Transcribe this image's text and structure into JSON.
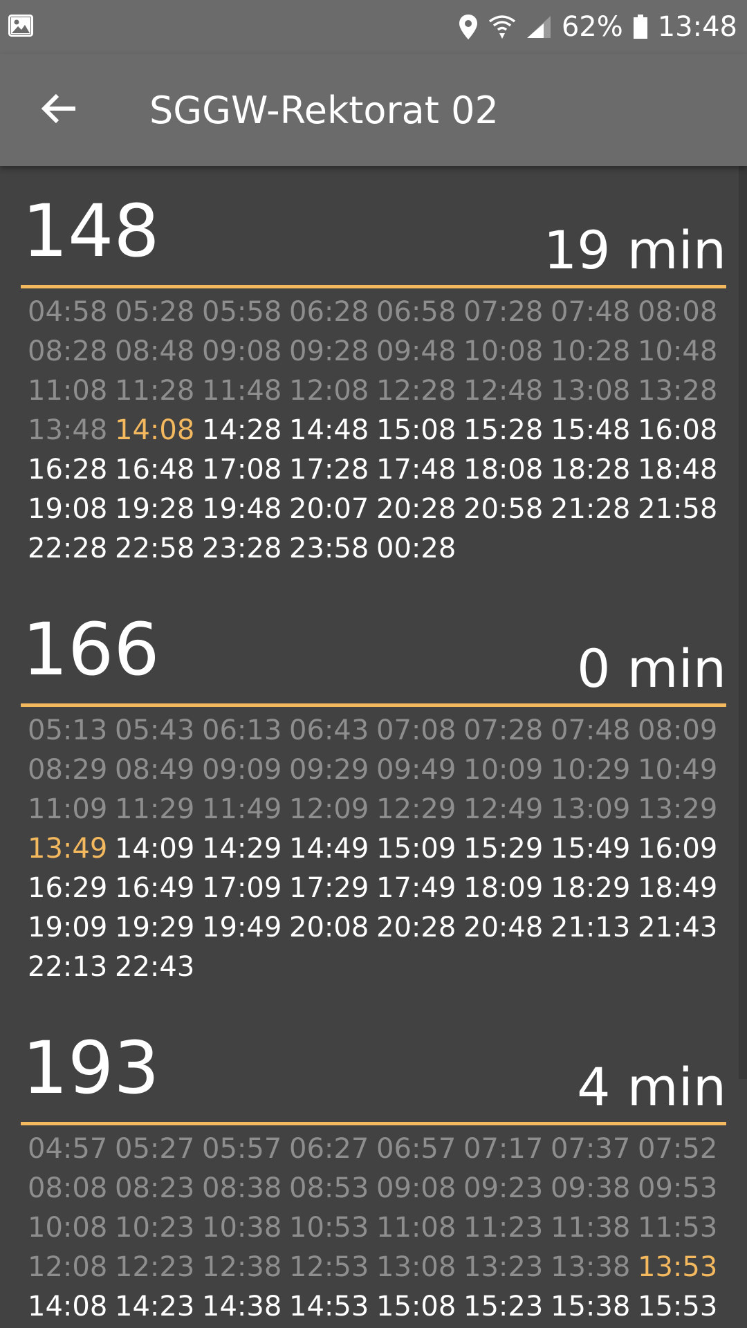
{
  "status_bar": {
    "battery": "62%",
    "time": "13:48",
    "icons": [
      "gallery-icon",
      "location-icon",
      "wifi-icon",
      "signal-icon",
      "battery-icon"
    ]
  },
  "app_bar": {
    "title": "SGGW-Rektorat 02",
    "back_icon": "back-arrow-icon"
  },
  "colors": {
    "accent": "#f4b95e",
    "background": "#424242",
    "toolbar": "#6b6b6b",
    "past_time": "#8e8e8e",
    "upcoming_time": "#ffffff"
  },
  "lines": [
    {
      "number": "148",
      "eta": "19 min",
      "times": [
        {
          "t": "04:58",
          "s": "past"
        },
        {
          "t": "05:28",
          "s": "past"
        },
        {
          "t": "05:58",
          "s": "past"
        },
        {
          "t": "06:28",
          "s": "past"
        },
        {
          "t": "06:58",
          "s": "past"
        },
        {
          "t": "07:28",
          "s": "past"
        },
        {
          "t": "07:48",
          "s": "past"
        },
        {
          "t": "08:08",
          "s": "past"
        },
        {
          "t": "08:28",
          "s": "past"
        },
        {
          "t": "08:48",
          "s": "past"
        },
        {
          "t": "09:08",
          "s": "past"
        },
        {
          "t": "09:28",
          "s": "past"
        },
        {
          "t": "09:48",
          "s": "past"
        },
        {
          "t": "10:08",
          "s": "past"
        },
        {
          "t": "10:28",
          "s": "past"
        },
        {
          "t": "10:48",
          "s": "past"
        },
        {
          "t": "11:08",
          "s": "past"
        },
        {
          "t": "11:28",
          "s": "past"
        },
        {
          "t": "11:48",
          "s": "past"
        },
        {
          "t": "12:08",
          "s": "past"
        },
        {
          "t": "12:28",
          "s": "past"
        },
        {
          "t": "12:48",
          "s": "past"
        },
        {
          "t": "13:08",
          "s": "past"
        },
        {
          "t": "13:28",
          "s": "past"
        },
        {
          "t": "13:48",
          "s": "past"
        },
        {
          "t": "14:08",
          "s": "next"
        },
        {
          "t": "14:28",
          "s": "upcoming"
        },
        {
          "t": "14:48",
          "s": "upcoming"
        },
        {
          "t": "15:08",
          "s": "upcoming"
        },
        {
          "t": "15:28",
          "s": "upcoming"
        },
        {
          "t": "15:48",
          "s": "upcoming"
        },
        {
          "t": "16:08",
          "s": "upcoming"
        },
        {
          "t": "16:28",
          "s": "upcoming"
        },
        {
          "t": "16:48",
          "s": "upcoming"
        },
        {
          "t": "17:08",
          "s": "upcoming"
        },
        {
          "t": "17:28",
          "s": "upcoming"
        },
        {
          "t": "17:48",
          "s": "upcoming"
        },
        {
          "t": "18:08",
          "s": "upcoming"
        },
        {
          "t": "18:28",
          "s": "upcoming"
        },
        {
          "t": "18:48",
          "s": "upcoming"
        },
        {
          "t": "19:08",
          "s": "upcoming"
        },
        {
          "t": "19:28",
          "s": "upcoming"
        },
        {
          "t": "19:48",
          "s": "upcoming"
        },
        {
          "t": "20:07",
          "s": "upcoming"
        },
        {
          "t": "20:28",
          "s": "upcoming"
        },
        {
          "t": "20:58",
          "s": "upcoming"
        },
        {
          "t": "21:28",
          "s": "upcoming"
        },
        {
          "t": "21:58",
          "s": "upcoming"
        },
        {
          "t": "22:28",
          "s": "upcoming"
        },
        {
          "t": "22:58",
          "s": "upcoming"
        },
        {
          "t": "23:28",
          "s": "upcoming"
        },
        {
          "t": "23:58",
          "s": "upcoming"
        },
        {
          "t": "00:28",
          "s": "upcoming"
        }
      ]
    },
    {
      "number": "166",
      "eta": "0 min",
      "times": [
        {
          "t": "05:13",
          "s": "past"
        },
        {
          "t": "05:43",
          "s": "past"
        },
        {
          "t": "06:13",
          "s": "past"
        },
        {
          "t": "06:43",
          "s": "past"
        },
        {
          "t": "07:08",
          "s": "past"
        },
        {
          "t": "07:28",
          "s": "past"
        },
        {
          "t": "07:48",
          "s": "past"
        },
        {
          "t": "08:09",
          "s": "past"
        },
        {
          "t": "08:29",
          "s": "past"
        },
        {
          "t": "08:49",
          "s": "past"
        },
        {
          "t": "09:09",
          "s": "past"
        },
        {
          "t": "09:29",
          "s": "past"
        },
        {
          "t": "09:49",
          "s": "past"
        },
        {
          "t": "10:09",
          "s": "past"
        },
        {
          "t": "10:29",
          "s": "past"
        },
        {
          "t": "10:49",
          "s": "past"
        },
        {
          "t": "11:09",
          "s": "past"
        },
        {
          "t": "11:29",
          "s": "past"
        },
        {
          "t": "11:49",
          "s": "past"
        },
        {
          "t": "12:09",
          "s": "past"
        },
        {
          "t": "12:29",
          "s": "past"
        },
        {
          "t": "12:49",
          "s": "past"
        },
        {
          "t": "13:09",
          "s": "past"
        },
        {
          "t": "13:29",
          "s": "past"
        },
        {
          "t": "13:49",
          "s": "next"
        },
        {
          "t": "14:09",
          "s": "upcoming"
        },
        {
          "t": "14:29",
          "s": "upcoming"
        },
        {
          "t": "14:49",
          "s": "upcoming"
        },
        {
          "t": "15:09",
          "s": "upcoming"
        },
        {
          "t": "15:29",
          "s": "upcoming"
        },
        {
          "t": "15:49",
          "s": "upcoming"
        },
        {
          "t": "16:09",
          "s": "upcoming"
        },
        {
          "t": "16:29",
          "s": "upcoming"
        },
        {
          "t": "16:49",
          "s": "upcoming"
        },
        {
          "t": "17:09",
          "s": "upcoming"
        },
        {
          "t": "17:29",
          "s": "upcoming"
        },
        {
          "t": "17:49",
          "s": "upcoming"
        },
        {
          "t": "18:09",
          "s": "upcoming"
        },
        {
          "t": "18:29",
          "s": "upcoming"
        },
        {
          "t": "18:49",
          "s": "upcoming"
        },
        {
          "t": "19:09",
          "s": "upcoming"
        },
        {
          "t": "19:29",
          "s": "upcoming"
        },
        {
          "t": "19:49",
          "s": "upcoming"
        },
        {
          "t": "20:08",
          "s": "upcoming"
        },
        {
          "t": "20:28",
          "s": "upcoming"
        },
        {
          "t": "20:48",
          "s": "upcoming"
        },
        {
          "t": "21:13",
          "s": "upcoming"
        },
        {
          "t": "21:43",
          "s": "upcoming"
        },
        {
          "t": "22:13",
          "s": "upcoming"
        },
        {
          "t": "22:43",
          "s": "upcoming"
        }
      ]
    },
    {
      "number": "193",
      "eta": "4 min",
      "times": [
        {
          "t": "04:57",
          "s": "past"
        },
        {
          "t": "05:27",
          "s": "past"
        },
        {
          "t": "05:57",
          "s": "past"
        },
        {
          "t": "06:27",
          "s": "past"
        },
        {
          "t": "06:57",
          "s": "past"
        },
        {
          "t": "07:17",
          "s": "past"
        },
        {
          "t": "07:37",
          "s": "past"
        },
        {
          "t": "07:52",
          "s": "past"
        },
        {
          "t": "08:08",
          "s": "past"
        },
        {
          "t": "08:23",
          "s": "past"
        },
        {
          "t": "08:38",
          "s": "past"
        },
        {
          "t": "08:53",
          "s": "past"
        },
        {
          "t": "09:08",
          "s": "past"
        },
        {
          "t": "09:23",
          "s": "past"
        },
        {
          "t": "09:38",
          "s": "past"
        },
        {
          "t": "09:53",
          "s": "past"
        },
        {
          "t": "10:08",
          "s": "past"
        },
        {
          "t": "10:23",
          "s": "past"
        },
        {
          "t": "10:38",
          "s": "past"
        },
        {
          "t": "10:53",
          "s": "past"
        },
        {
          "t": "11:08",
          "s": "past"
        },
        {
          "t": "11:23",
          "s": "past"
        },
        {
          "t": "11:38",
          "s": "past"
        },
        {
          "t": "11:53",
          "s": "past"
        },
        {
          "t": "12:08",
          "s": "past"
        },
        {
          "t": "12:23",
          "s": "past"
        },
        {
          "t": "12:38",
          "s": "past"
        },
        {
          "t": "12:53",
          "s": "past"
        },
        {
          "t": "13:08",
          "s": "past"
        },
        {
          "t": "13:23",
          "s": "past"
        },
        {
          "t": "13:38",
          "s": "past"
        },
        {
          "t": "13:53",
          "s": "next"
        },
        {
          "t": "14:08",
          "s": "upcoming"
        },
        {
          "t": "14:23",
          "s": "upcoming"
        },
        {
          "t": "14:38",
          "s": "upcoming"
        },
        {
          "t": "14:53",
          "s": "upcoming"
        },
        {
          "t": "15:08",
          "s": "upcoming"
        },
        {
          "t": "15:23",
          "s": "upcoming"
        },
        {
          "t": "15:38",
          "s": "upcoming"
        },
        {
          "t": "15:53",
          "s": "upcoming"
        }
      ]
    }
  ]
}
